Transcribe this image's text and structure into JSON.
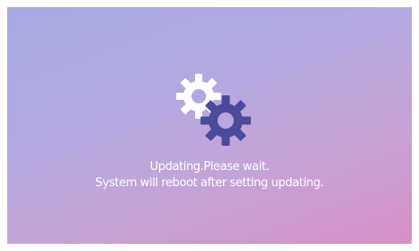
{
  "dialog": {
    "line1": "Updating.Please wait.",
    "line2": "System will reboot after setting updating."
  },
  "icons": {
    "gears": "gears-icon"
  },
  "colors": {
    "gear_white": "#ffffff",
    "gear_navy": "#4a4b9a",
    "background_start": "#a7a9e3",
    "background_end": "#d68fc4"
  }
}
